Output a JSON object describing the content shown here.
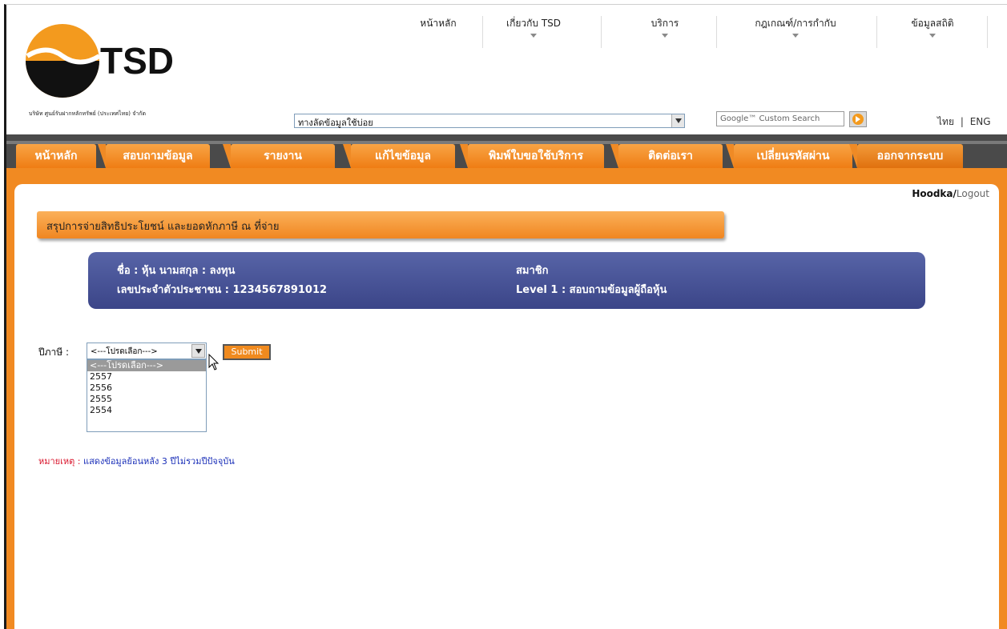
{
  "header": {
    "logo_text": "TSD",
    "company_name": "บริษัท ศูนย์รับฝากหลักทรัพย์ (ประเทศไทย) จำกัด",
    "topnav": [
      {
        "label": "หน้าหลัก",
        "has_arrow": false
      },
      {
        "label": "เกี่ยวกับ TSD",
        "has_arrow": true
      },
      {
        "label": "บริการ",
        "has_arrow": true
      },
      {
        "label": "กฎเกณฑ์/การกำกับ",
        "has_arrow": true
      },
      {
        "label": "ข้อมูลสถิติ",
        "has_arrow": true
      }
    ],
    "shortcut_select": "ทางลัดข้อมูลใช้บ่อย",
    "search_placeholder": "Google™ Custom Search",
    "lang": {
      "thai": "ไทย",
      "sep": "|",
      "eng": "ENG"
    }
  },
  "navbar": {
    "tabs": [
      "หน้าหลัก",
      "สอบถามข้อมูล",
      "รายงาน",
      "แก้ไขข้อมูล",
      "พิมพ์ใบขอใช้บริการ",
      "ติดต่อเรา",
      "เปลี่ยนรหัสผ่าน",
      "ออกจากระบบ"
    ]
  },
  "user": {
    "name": "Hoodka",
    "sep": "/",
    "logout": "Logout"
  },
  "page": {
    "title": "สรุปการจ่ายสิทธิประโยชน์ และยอดหักภาษี ณ ที่จ่าย",
    "info": {
      "name": "ชื่อ : หุ้น     นามสกุล : ลงทุน",
      "idcard": "เลขประจำตัวประชาชน : 1234567891012",
      "member": "สมาชิก",
      "level": "Level 1   :  สอบถามข้อมูลผู้ถือหุ้น"
    },
    "form": {
      "year_label": "ปีภาษี :",
      "year_selected": "<---โปรดเลือก--->",
      "year_options": [
        "<---โปรดเลือก--->",
        "2557",
        "2556",
        "2555",
        "2554"
      ],
      "submit_label": "Submit"
    },
    "note": {
      "label": "หมายเหตุ :",
      "text": "แสดงข้อมูลย้อนหลัง 3 ปีไม่รวมปีปัจจุบัน"
    }
  },
  "colors": {
    "orange": "#f18a22",
    "info_bg": "#46509a",
    "note_red": "#d9142b",
    "note_blue": "#1a2fb8"
  }
}
